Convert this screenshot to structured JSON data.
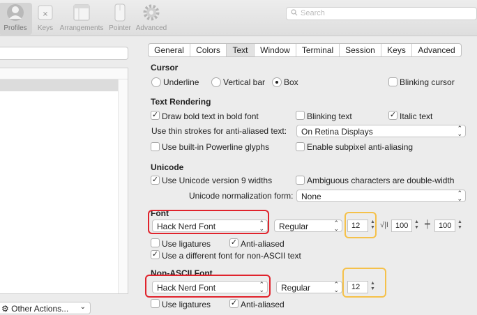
{
  "toolbar": {
    "items": [
      {
        "label": "Profiles",
        "icon": "profile-icon"
      },
      {
        "label": "Keys",
        "icon": "keys-icon"
      },
      {
        "label": "Arrangements",
        "icon": "arrangements-icon"
      },
      {
        "label": "Pointer",
        "icon": "pointer-icon"
      },
      {
        "label": "Advanced",
        "icon": "gear-icon"
      }
    ],
    "search_placeholder": "Search"
  },
  "left": {
    "other_actions_label": "Other Actions..."
  },
  "tabs": [
    "General",
    "Colors",
    "Text",
    "Window",
    "Terminal",
    "Session",
    "Keys",
    "Advanced"
  ],
  "selected_tab": "Text",
  "cursor": {
    "title": "Cursor",
    "underline": "Underline",
    "vertical_bar": "Vertical bar",
    "box": "Box",
    "blinking": "Blinking cursor"
  },
  "text_rendering": {
    "title": "Text Rendering",
    "draw_bold": "Draw bold text in bold font",
    "blinking_text": "Blinking text",
    "italic_text": "Italic text",
    "thin_strokes_label": "Use thin strokes for anti-aliased text:",
    "thin_strokes_value": "On Retina Displays",
    "powerline": "Use built-in Powerline glyphs",
    "subpixel": "Enable subpixel anti-aliasing"
  },
  "unicode": {
    "title": "Unicode",
    "v9_widths": "Use Unicode version 9 widths",
    "ambiguous": "Ambiguous characters are double-width",
    "normalization_label": "Unicode normalization form:",
    "normalization_value": "None"
  },
  "font": {
    "title": "Font",
    "family": "Hack Nerd Font",
    "style": "Regular",
    "size": "12",
    "h_spacing": "100",
    "v_spacing": "100",
    "ligatures": "Use ligatures",
    "anti_aliased": "Anti-aliased",
    "different_font": "Use a different font for non-ASCII text"
  },
  "non_ascii_font": {
    "title": "Non-ASCII Font",
    "family": "Hack Nerd Font",
    "style": "Regular",
    "size": "12",
    "ligatures": "Use ligatures",
    "anti_aliased": "Anti-aliased"
  },
  "colors": {
    "highlight_red": "#e0232c",
    "highlight_yellow": "#f5c14a",
    "selected_tab_bg": "#e2e2e2"
  }
}
